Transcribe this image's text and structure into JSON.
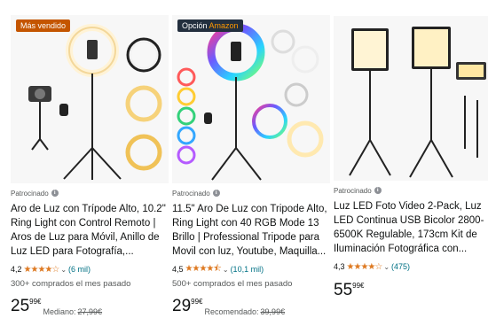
{
  "colors": {
    "best_seller_bg": "#c45500",
    "choice_bg": "#232f3e",
    "choice_accent": "#ff9900",
    "star": "#de7921",
    "link": "#007185"
  },
  "products": [
    {
      "badge": "Más vendido",
      "sponsored": "Patrocinado",
      "title": "Aro de Luz con Trípode Alto, 10.2\" Ring Light con Control Remoto | Aros de Luz para Móvil, Anillo de Luz LED para Fotografía,...",
      "rating": "4,2",
      "stars": 4.2,
      "reviews": "(6 mil)",
      "bought": "300+ comprados el mes pasado",
      "price_whole": "25",
      "price_cents": "99",
      "currency": "€",
      "list_label": "Mediano:",
      "list_price": "27,99€"
    },
    {
      "badge_main": "Opción ",
      "badge_brand": "Amazon",
      "sponsored": "Patrocinado",
      "title": "11.5\" Aro De Luz con Tripode Alto, Ring Light con 40 RGB Mode 13 Brillo | Professional Tripode para Movil con luz, Youtube, Maquilla...",
      "rating": "4,5",
      "stars": 4.5,
      "reviews": "(10,1 mil)",
      "bought": "500+ comprados el mes pasado",
      "price_whole": "29",
      "price_cents": "99",
      "currency": "€",
      "list_label": "Recomendado:",
      "list_price": "39,99€"
    },
    {
      "sponsored": "Patrocinado",
      "title": "Luz LED Foto Video 2-Pack, Luz LED Continua USB Bicolor 2800-6500K Regulable, 173cm Kit de Iluminación Fotográfica con...",
      "rating": "4,3",
      "stars": 4.3,
      "reviews": "(475)",
      "price_whole": "55",
      "price_cents": "99",
      "currency": "€"
    }
  ],
  "icons": {
    "info": "info-icon",
    "chevron": "chevron-down-icon",
    "star": "star-icon"
  },
  "glyphs": {
    "info": "i",
    "chevron": "⌄",
    "stars_4_2": "★★★★☆",
    "stars_4_5": "★★★★⯪",
    "stars_4_3": "★★★★☆"
  }
}
